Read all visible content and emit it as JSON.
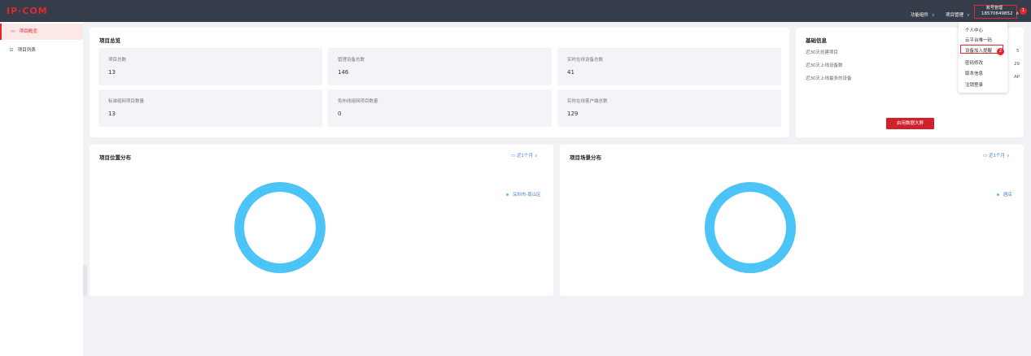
{
  "app": {
    "logo": "IP·COM"
  },
  "topbar": {
    "nav_widgets": "功能组件",
    "nav_project": "项目管理",
    "account_title": "账号管理",
    "account_phone": "18570649852",
    "chevron": "∨",
    "badge1": "1"
  },
  "sidebar": {
    "items": [
      {
        "icon": "▭",
        "label": "项目概览"
      },
      {
        "icon": "☷",
        "label": "项目列表"
      }
    ]
  },
  "overview": {
    "title": "项目总览",
    "stats": [
      {
        "label": "项目总数",
        "value": "13"
      },
      {
        "label": "管理设备总数",
        "value": "146"
      },
      {
        "label": "实时在线设备总数",
        "value": "41"
      },
      {
        "label": "标准组网项目数量",
        "value": "13"
      },
      {
        "label": "免布线组网项目数量",
        "value": "0"
      },
      {
        "label": "实时在线客户端总数",
        "value": "129"
      }
    ]
  },
  "basic": {
    "title": "基础信息",
    "rows": [
      {
        "label": "近30天创建项目",
        "value": "5"
      },
      {
        "label": "近30天上线设备数",
        "value": "29"
      },
      {
        "label": "近30天上线最多的设备",
        "value": "AP"
      }
    ],
    "button": "启用数据大屏"
  },
  "location": {
    "title": "项目位置分布",
    "period": "近1个月",
    "legend": "深圳市-南山区"
  },
  "scene": {
    "title": "项目场景分布",
    "period": "近1个月",
    "legend": "酒店"
  },
  "dropdown": {
    "items": [
      "个人中心",
      "云平台唯一码",
      "设备加入提醒",
      "密码修改",
      "版本信息",
      "注销登录"
    ],
    "badge2": "2"
  },
  "icons": {
    "calendar": "calendar-icon"
  },
  "colors": {
    "accent": "#e0292e",
    "donut": "#4dc4f7",
    "topbar": "#363d4a"
  },
  "chart_data": [
    {
      "type": "pie",
      "title": "项目位置分布",
      "categories": [
        "深圳市-南山区"
      ],
      "values": [
        13
      ]
    },
    {
      "type": "pie",
      "title": "项目场景分布",
      "categories": [
        "酒店"
      ],
      "values": [
        13
      ]
    }
  ]
}
